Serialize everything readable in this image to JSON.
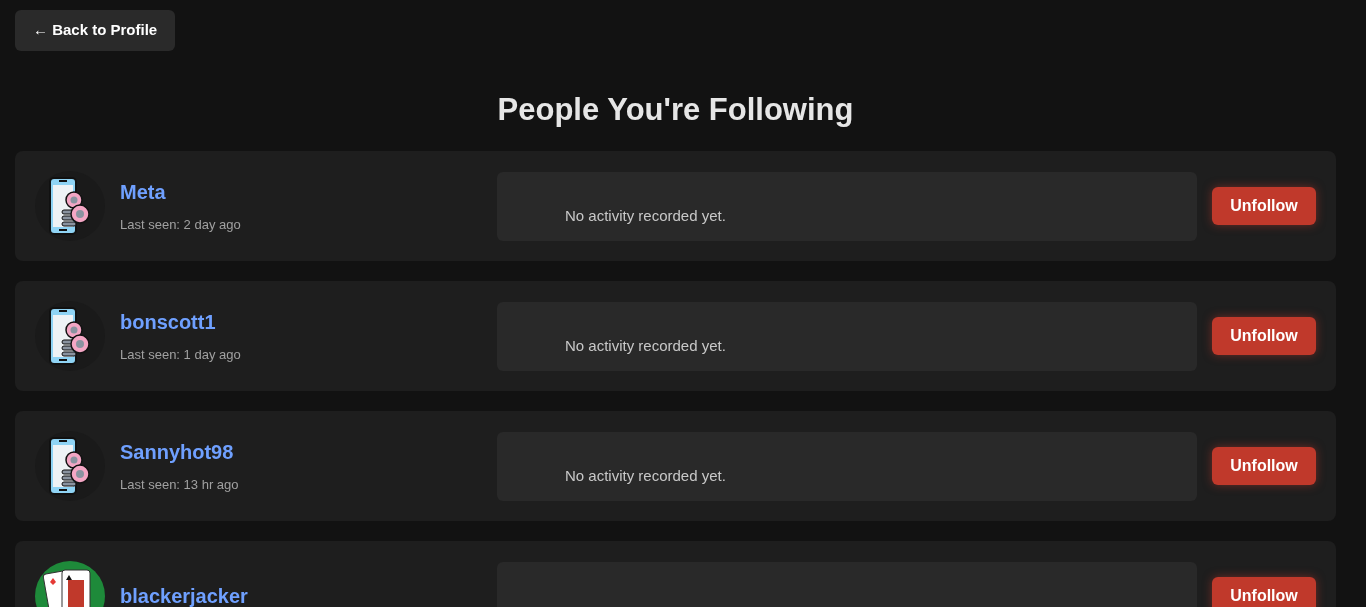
{
  "back_button": {
    "label": "← Back to Profile"
  },
  "title": "People You're Following",
  "following": [
    {
      "name": "Meta",
      "last_seen": "Last seen: 2 day ago",
      "kind": "phone",
      "activity": "No activity recorded yet.",
      "action": "Unfollow"
    },
    {
      "name": "bonscott1",
      "last_seen": "Last seen: 1 day ago",
      "kind": "phone",
      "activity": "No activity recorded yet.",
      "action": "Unfollow"
    },
    {
      "name": "Sannyhot98",
      "last_seen": "Last seen: 13 hr ago",
      "kind": "phone",
      "activity": "No activity recorded yet.",
      "action": "Unfollow"
    },
    {
      "name": "blackerjacker",
      "kind": "cards",
      "action": "Unfollow"
    }
  ]
}
